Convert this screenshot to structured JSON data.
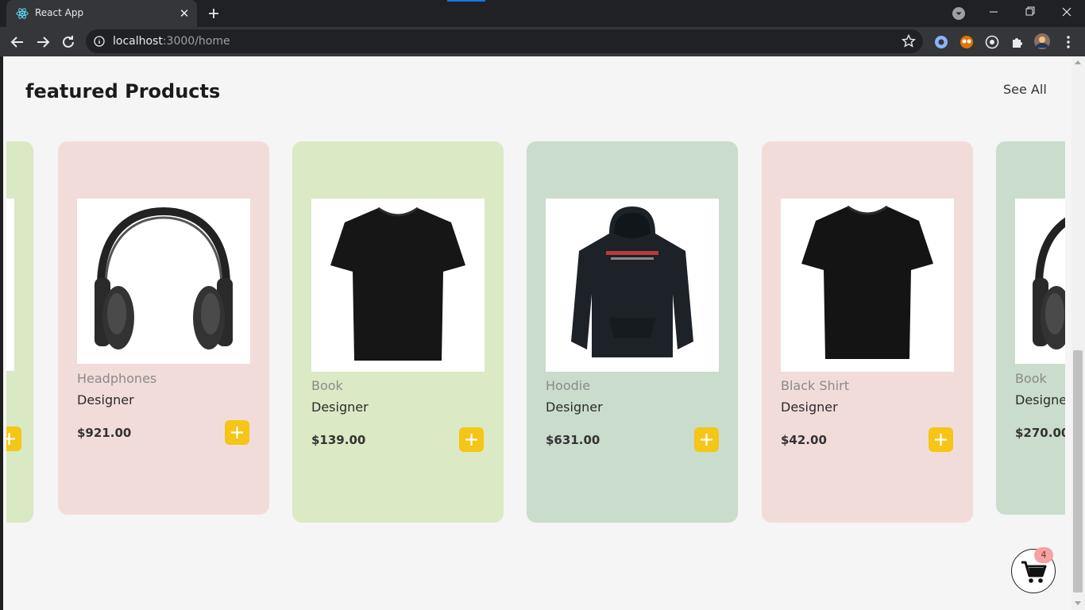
{
  "browser": {
    "tab_title": "React App",
    "url_host": "localhost",
    "url_rest": ":3000/home"
  },
  "page": {
    "section_title": "featured Products",
    "see_all": "See All",
    "cart_count": "4"
  },
  "products": [
    {
      "name": "",
      "subtitle": "",
      "price": "",
      "bg": "#d8e9c4"
    },
    {
      "name": "Headphones",
      "subtitle": "Designer",
      "price": "$921.00",
      "bg": "#f2dcda",
      "image": "headphones"
    },
    {
      "name": "Book",
      "subtitle": "Designer",
      "price": "$139.00",
      "bg": "#dbe9c5",
      "image": "tshirt"
    },
    {
      "name": "Hoodie",
      "subtitle": "Designer",
      "price": "$631.00",
      "bg": "#cadccb",
      "image": "hoodie"
    },
    {
      "name": "Black Shirt",
      "subtitle": "Designer",
      "price": "$42.00",
      "bg": "#f2dcda",
      "image": "tshirt"
    },
    {
      "name": "Book",
      "subtitle": "Designe",
      "price": "$270.00",
      "bg": "#cadccb",
      "image": "headphones"
    }
  ],
  "colors": {
    "accent": "#f5c518",
    "page_bg": "#f5f5f5",
    "chrome_dark": "#202124",
    "chrome_toolbar": "#35363a"
  }
}
